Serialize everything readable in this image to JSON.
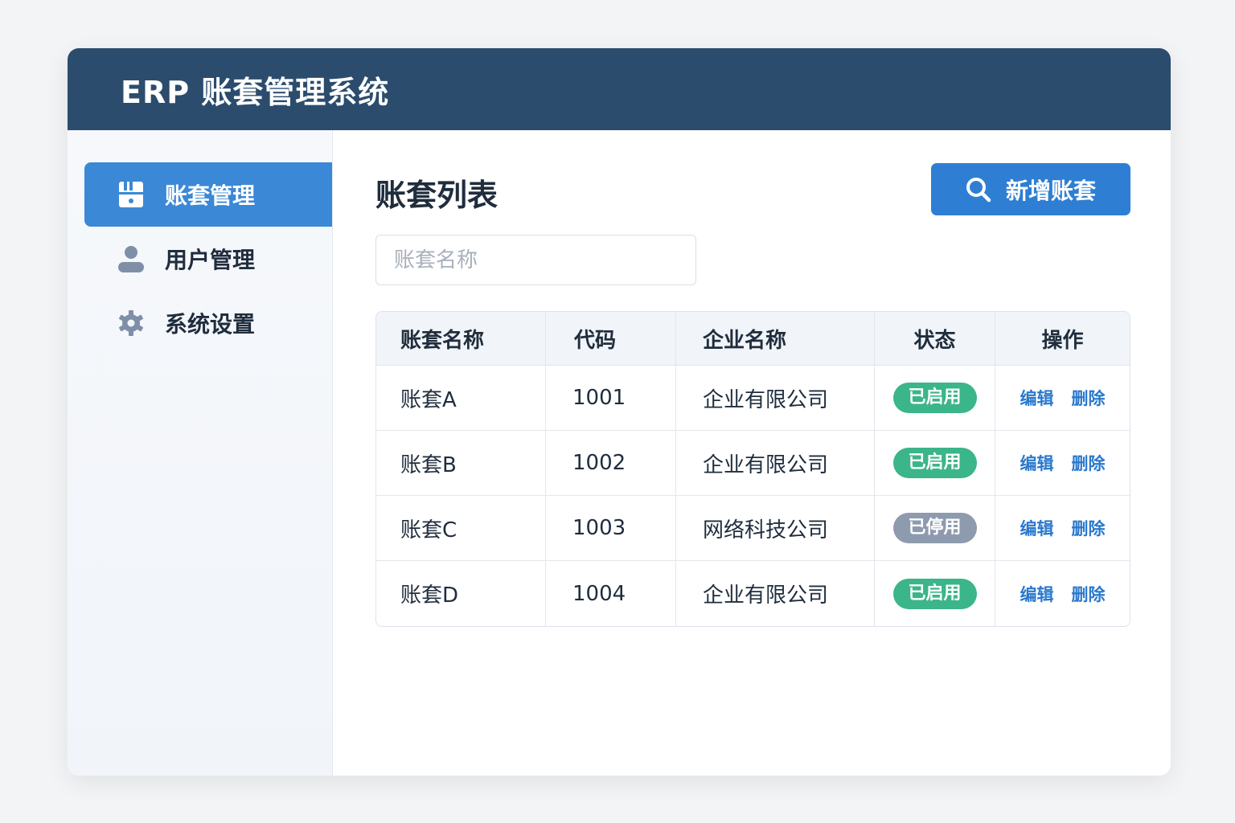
{
  "header": {
    "title": "ERP 账套管理系统"
  },
  "sidebar": {
    "items": [
      {
        "label": "账套管理",
        "icon": "ledger-icon",
        "active": true
      },
      {
        "label": "用户管理",
        "icon": "user-icon"
      },
      {
        "label": "系统设置",
        "icon": "gear-icon"
      }
    ]
  },
  "main": {
    "title": "账套列表",
    "add_button": "新增账套",
    "search_placeholder": "账套名称"
  },
  "table": {
    "headers": [
      "账套名称",
      "代码",
      "企业名称",
      "状态",
      "操作"
    ],
    "rows": [
      {
        "name": "账套A",
        "code": "1001",
        "company": "企业有限公司",
        "status": "已启用",
        "edit": "编辑",
        "delete": "删除"
      },
      {
        "name": "账套B",
        "code": "1002",
        "company": "企业有限公司",
        "status": "已启用",
        "edit": "编辑",
        "delete": "删除"
      },
      {
        "name": "账套C",
        "code": "1003",
        "company": "网络科技公司",
        "status": "已停用",
        "edit": "编辑",
        "delete": "删除"
      },
      {
        "name": "账套D",
        "code": "1004",
        "company": "企业有限公司",
        "status": "已启用",
        "edit": "编辑",
        "delete": "删除"
      }
    ]
  },
  "colors": {
    "header": "#2b4c6d",
    "accent": "#3b88d6",
    "enabled": "#3bb58a",
    "disabled": "#8e9aae",
    "link": "#2a78cc"
  }
}
